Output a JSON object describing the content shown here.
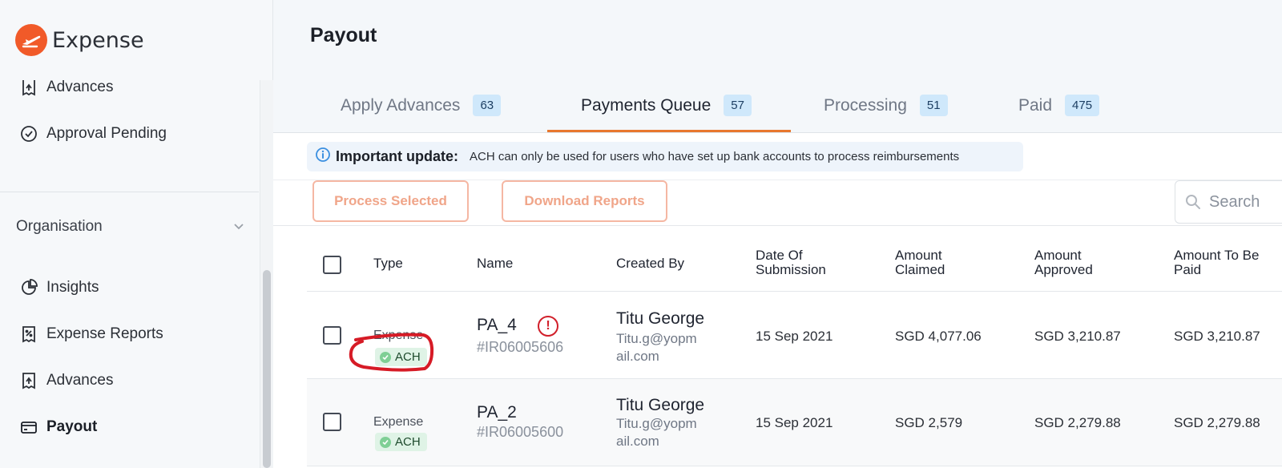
{
  "app": {
    "name": "Expense"
  },
  "sidebar": {
    "top_items": [
      {
        "label": "Advances",
        "icon": "advances-icon"
      },
      {
        "label": "Approval Pending",
        "icon": "check-circle-icon"
      }
    ],
    "section_title": "Organisation",
    "org_items": [
      {
        "label": "Insights",
        "icon": "pie-chart-icon"
      },
      {
        "label": "Expense Reports",
        "icon": "receipt-icon"
      },
      {
        "label": "Advances",
        "icon": "advances-icon"
      },
      {
        "label": "Payout",
        "icon": "card-icon",
        "active": true
      }
    ]
  },
  "page": {
    "title": "Payout"
  },
  "tabs": [
    {
      "label": "Apply Advances",
      "count": "63"
    },
    {
      "label": "Payments Queue",
      "count": "57",
      "active": true
    },
    {
      "label": "Processing",
      "count": "51"
    },
    {
      "label": "Paid",
      "count": "475"
    }
  ],
  "notice": {
    "title": "Important update:",
    "text": "ACH can only be used for users who have set up bank accounts to process reimbursements"
  },
  "toolbar": {
    "process_label": "Process Selected",
    "download_label": "Download Reports",
    "search_placeholder": "Search"
  },
  "table": {
    "headers": {
      "type": "Type",
      "name": "Name",
      "created_by": "Created By",
      "date_1": "Date Of",
      "date_2": "Submission",
      "claimed_1": "Amount",
      "claimed_2": "Claimed",
      "approved_1": "Amount",
      "approved_2": "Approved",
      "to_pay_1": "Amount To Be",
      "to_pay_2": "Paid"
    },
    "rows": [
      {
        "type": "Expense",
        "badge": "ACH",
        "name": "PA_4",
        "id": "#IR06005606",
        "creator": "Titu George",
        "email_1": "Titu.g@yopm",
        "email_2": "ail.com",
        "date": "15 Sep 2021",
        "claimed": "SGD 4,077.06",
        "approved": "SGD 3,210.87",
        "to_pay": "SGD 3,210.87",
        "alert": "!"
      },
      {
        "type": "Expense",
        "badge": "ACH",
        "name": "PA_2",
        "id": "#IR06005600",
        "creator": "Titu George",
        "email_1": "Titu.g@yopm",
        "email_2": "ail.com",
        "date": "15 Sep 2021",
        "claimed": "SGD 2,579",
        "approved": "SGD 2,279.88",
        "to_pay": "SGD 2,279.88"
      }
    ]
  },
  "colors": {
    "brand": "#f15a29",
    "accent_tab": "#e8772e",
    "badge_bg": "#cfe8fb",
    "alert": "#d11f2a"
  }
}
